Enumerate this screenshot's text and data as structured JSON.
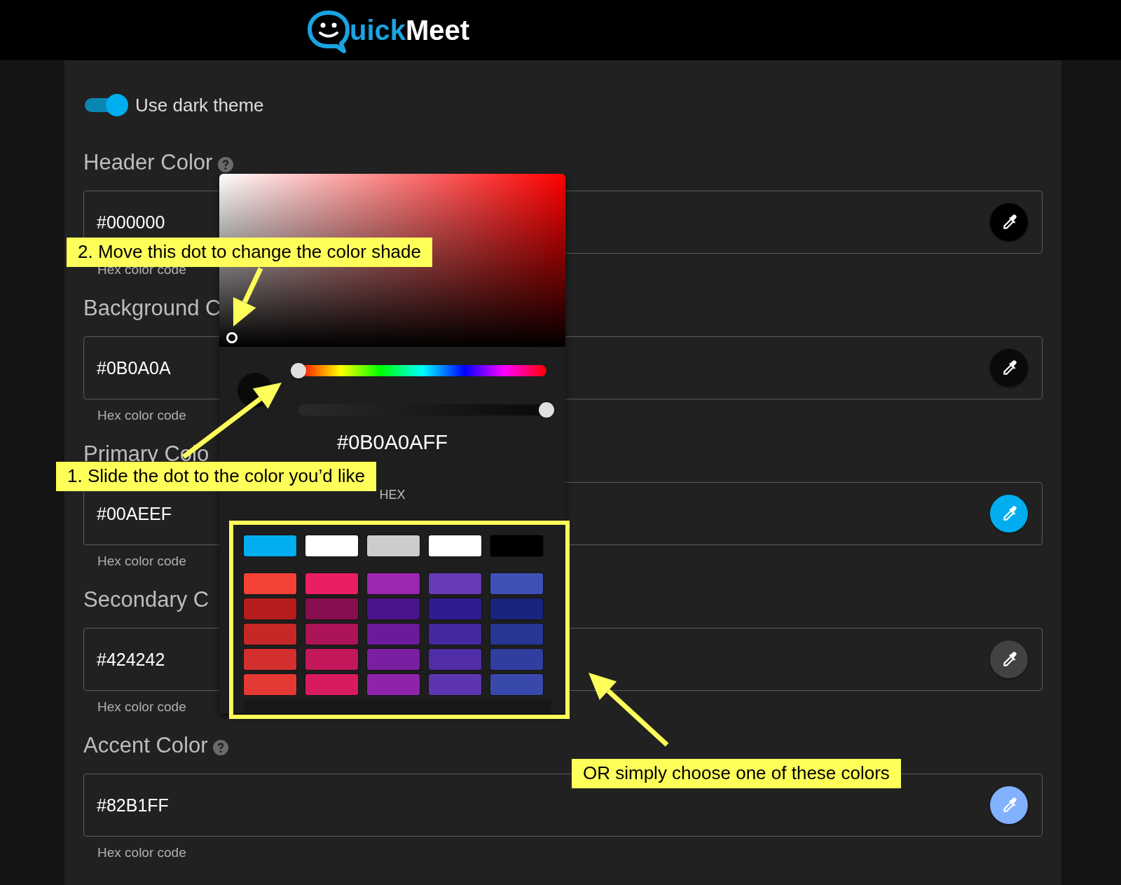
{
  "header": {
    "logo_part_1": "uick",
    "logo_part_2": "Meet"
  },
  "dark_theme": {
    "label": "Use dark theme",
    "on": true
  },
  "fields": [
    {
      "label": "Header Color",
      "help_icon": true,
      "value": "#000000",
      "color": "#000000",
      "helper": "Hex color code"
    },
    {
      "label": "Background C",
      "help_icon": false,
      "value": "#0B0A0A",
      "color": "#0b0a0a",
      "helper": "Hex color code"
    },
    {
      "label": "Primary Colo",
      "help_icon": false,
      "value": "#00AEEF",
      "color": "#00aeef",
      "helper": "Hex color code"
    },
    {
      "label": "Secondary C",
      "help_icon": false,
      "value": "#424242",
      "color": "#424242",
      "helper": "Hex color code"
    },
    {
      "label": "Accent Color",
      "help_icon": true,
      "value": "#82B1FF",
      "color": "#82b1ff",
      "helper": "Hex color code"
    }
  ],
  "color_picker": {
    "hue": {
      "level": 0
    },
    "alpha": {
      "level": 1
    },
    "hex_value": "#0B0A0AFF",
    "format_label": "HEX",
    "preset_swatches": [
      {
        "color": "#00aeef"
      },
      {
        "color": "#ffffff"
      },
      {
        "color": "#cccccc"
      },
      {
        "color": "#ffffff"
      },
      {
        "color": "#000000"
      }
    ],
    "swatches": [
      {
        "color": "#f44336"
      },
      {
        "color": "#e91e63"
      },
      {
        "color": "#9c27b0"
      },
      {
        "color": "#673ab7"
      },
      {
        "color": "#3f51b5"
      },
      {
        "color": "#b71c1c"
      },
      {
        "color": "#880e4f"
      },
      {
        "color": "#4a148c"
      },
      {
        "color": "#311b92"
      },
      {
        "color": "#1a237e"
      },
      {
        "color": "#c62828"
      },
      {
        "color": "#ad1457"
      },
      {
        "color": "#6a1b9a"
      },
      {
        "color": "#4527a0"
      },
      {
        "color": "#283593"
      },
      {
        "color": "#d32f2f"
      },
      {
        "color": "#c2185b"
      },
      {
        "color": "#7b1fa2"
      },
      {
        "color": "#512da8"
      },
      {
        "color": "#303f9f"
      },
      {
        "color": "#e53935"
      },
      {
        "color": "#d81b60"
      },
      {
        "color": "#8e24aa"
      },
      {
        "color": "#5e35b1"
      },
      {
        "color": "#3949ab"
      }
    ]
  },
  "annotations": [
    {
      "text": "2. Move this dot to change the color shade"
    },
    {
      "text": "1. Slide the dot to the color you’d like"
    },
    {
      "text": "OR simply choose one of these colors"
    }
  ]
}
